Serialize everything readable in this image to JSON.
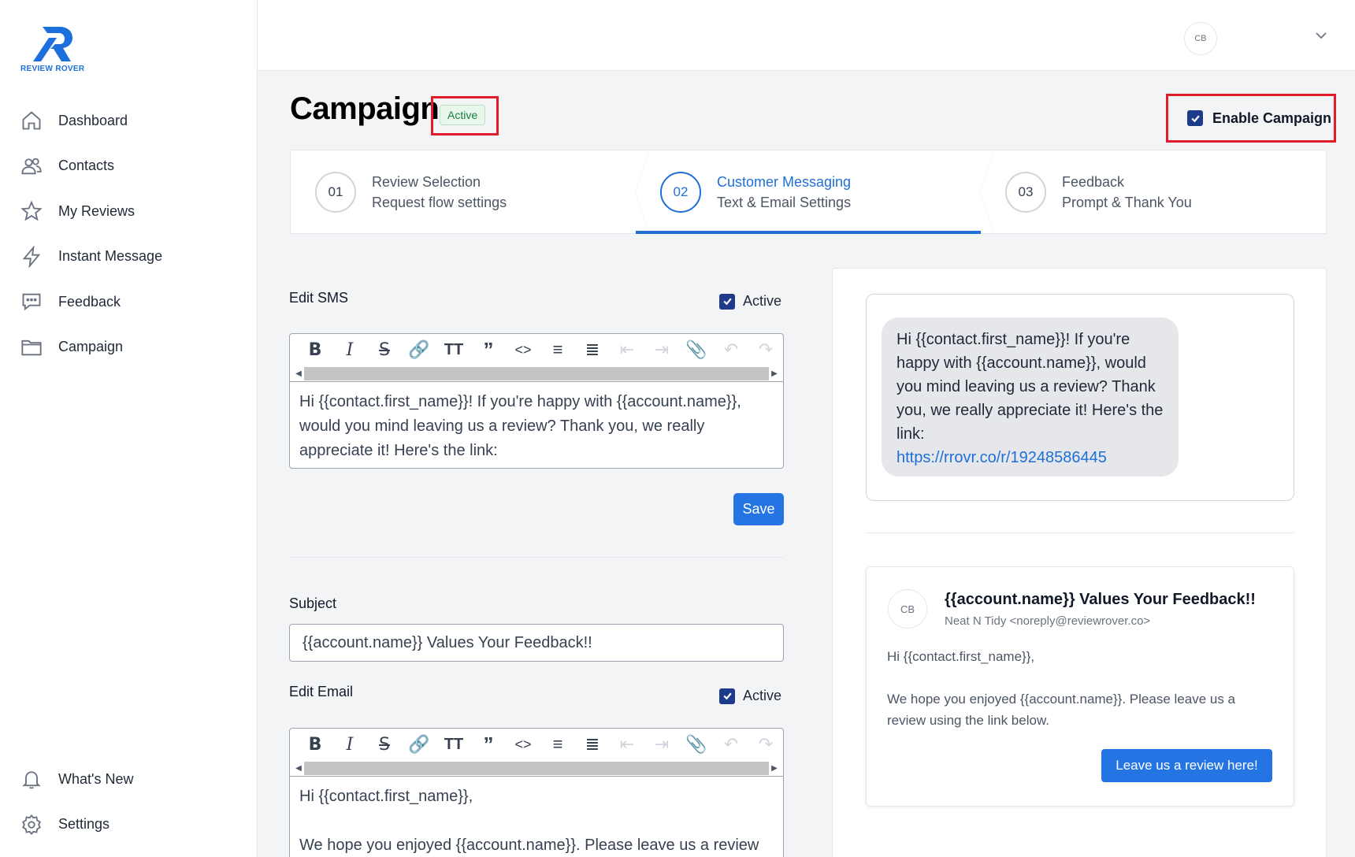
{
  "brand": {
    "name": "REVIEW ROVER",
    "accent": "#1f6fd6"
  },
  "sidebar": {
    "items": [
      {
        "label": "Dashboard",
        "icon": "home-icon"
      },
      {
        "label": "Contacts",
        "icon": "users-icon"
      },
      {
        "label": "My Reviews",
        "icon": "star-icon"
      },
      {
        "label": "Instant Message",
        "icon": "lightning-icon"
      },
      {
        "label": "Feedback",
        "icon": "chat-icon"
      },
      {
        "label": "Campaign",
        "icon": "folder-icon"
      }
    ],
    "bottom": [
      {
        "label": "What's New",
        "icon": "bell-icon"
      },
      {
        "label": "Settings",
        "icon": "gear-icon"
      }
    ]
  },
  "topbar": {
    "avatar": "CB"
  },
  "header": {
    "title": "Campaign",
    "status": "Active",
    "enable_label": "Enable Campaign",
    "enable_checked": true
  },
  "steps": [
    {
      "num": "01",
      "title": "Review Selection",
      "sub": "Request flow settings",
      "active": false
    },
    {
      "num": "02",
      "title": "Customer Messaging",
      "sub": "Text & Email Settings",
      "active": true
    },
    {
      "num": "03",
      "title": "Feedback",
      "sub": "Prompt & Thank You",
      "active": false
    }
  ],
  "sms": {
    "label": "Edit SMS",
    "active_label": "Active",
    "active": true,
    "body": "Hi {{contact.first_name}}! If you're happy with {{account.name}}, would you mind leaving us a review? Thank you, we really appreciate it! Here's the link:",
    "save_label": "Save"
  },
  "email": {
    "subject_label": "Subject",
    "subject_value": "{{account.name}} Values Your Feedback!!",
    "label": "Edit Email",
    "active_label": "Active",
    "active": true,
    "body_line1": "Hi {{contact.first_name}},",
    "body_line2": "We hope you enjoyed {{account.name}}. Please leave us a review"
  },
  "preview": {
    "sms_text": "Hi {{contact.first_name}}! If you're happy with {{account.name}}, would you mind leaving us a review? Thank you, we really appreciate it! Here's the link:",
    "sms_link": "https://rrovr.co/r/19248586445",
    "email_avatar": "CB",
    "email_subject": "{{account.name}} Values Your Feedback!!",
    "email_from": "Neat N Tidy <noreply@reviewrover.co>",
    "email_greeting": "Hi {{contact.first_name}},",
    "email_text": "We hope you enjoyed {{account.name}}. Please leave us a review using the link below.",
    "email_button": "Leave us a review here!"
  }
}
